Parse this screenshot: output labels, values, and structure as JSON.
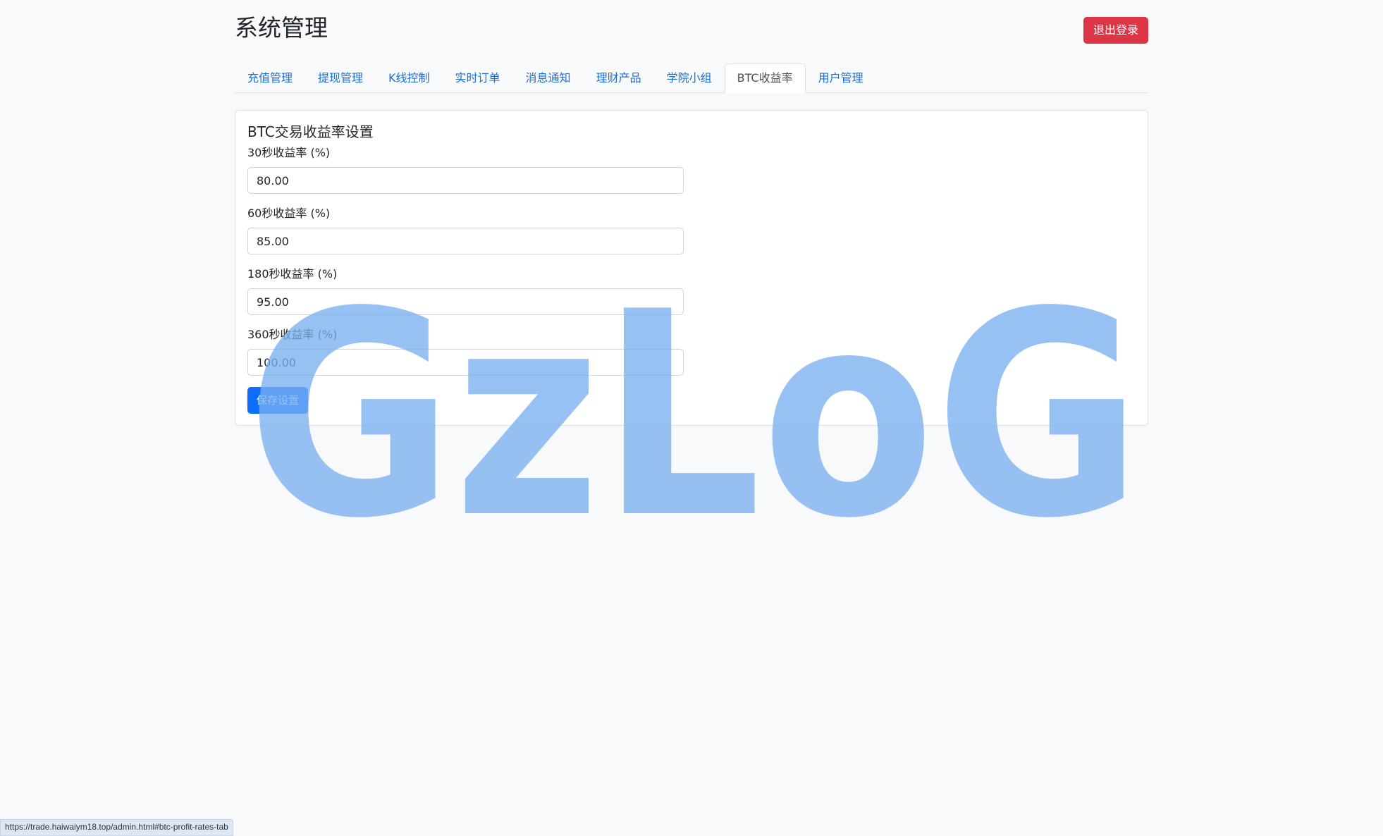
{
  "header": {
    "title": "系统管理",
    "logout_label": "退出登录"
  },
  "tabs": [
    {
      "label": "充值管理",
      "active": false
    },
    {
      "label": "提现管理",
      "active": false
    },
    {
      "label": "K线控制",
      "active": false
    },
    {
      "label": "实时订单",
      "active": false
    },
    {
      "label": "消息通知",
      "active": false
    },
    {
      "label": "理财产品",
      "active": false
    },
    {
      "label": "学院小组",
      "active": false
    },
    {
      "label": "BTC收益率",
      "active": true
    },
    {
      "label": "用户管理",
      "active": false
    }
  ],
  "form": {
    "title": "BTC交易收益率设置",
    "fields": [
      {
        "label": "30秒收益率 (%)",
        "value": "80.00"
      },
      {
        "label": "60秒收益率 (%)",
        "value": "85.00"
      },
      {
        "label": "180秒收益率 (%)",
        "value": "95.00"
      },
      {
        "label": "360秒收益率 (%)",
        "value": "100.00"
      }
    ],
    "save_label": "保存设置"
  },
  "watermark": {
    "text": "GzLoG",
    "color": "#7aaef0"
  },
  "status_bar": {
    "url": "https://trade.haiwaiym18.top/admin.html#btc-profit-rates-tab"
  },
  "colors": {
    "primary": "#0d6efd",
    "danger": "#dc3545",
    "tab_link": "#1a6fd6",
    "background": "#f8f9fa"
  }
}
